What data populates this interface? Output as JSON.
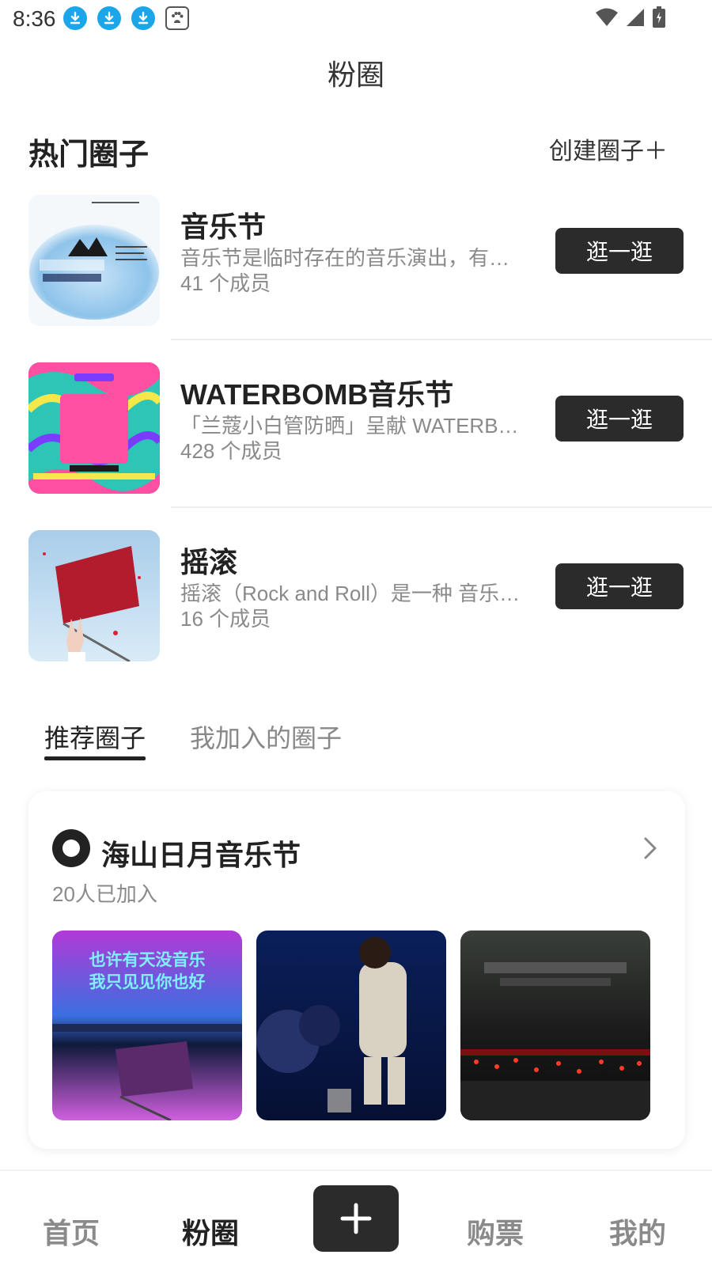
{
  "status_bar": {
    "time": "8:36"
  },
  "header": {
    "title": "粉圈"
  },
  "hot": {
    "section_title": "热门圈子",
    "create_label": "创建圈子＋",
    "items": [
      {
        "name": "音乐节",
        "desc": "音乐节是临时存在的音乐演出，有…",
        "members": "41 个成员",
        "button": "逛一逛"
      },
      {
        "name": "WATERBOMB音乐节",
        "desc": "「兰蔻小白管防晒」呈献 WATERB…",
        "members": "428 个成员",
        "button": "逛一逛"
      },
      {
        "name": "摇滚",
        "desc": "摇滚（Rock and Roll）是一种 音乐…",
        "members": "16 个成员",
        "button": "逛一逛"
      }
    ]
  },
  "tabs": [
    {
      "label": "推荐圈子"
    },
    {
      "label": "我加入的圈子"
    }
  ],
  "recommend": {
    "title": "海山日月音乐节",
    "joined": "20人已加入",
    "photo1_text1": "也许有天没音乐",
    "photo1_text2": "我只见见你也好"
  },
  "bottom_nav": [
    {
      "label": "首页"
    },
    {
      "label": "粉圈"
    },
    {
      "label": "购票"
    },
    {
      "label": "我的"
    }
  ],
  "colors": {
    "button_bg": "#2b2b2b",
    "download_icon": "#1aa6e8",
    "muted_text": "#8a8a8a"
  }
}
